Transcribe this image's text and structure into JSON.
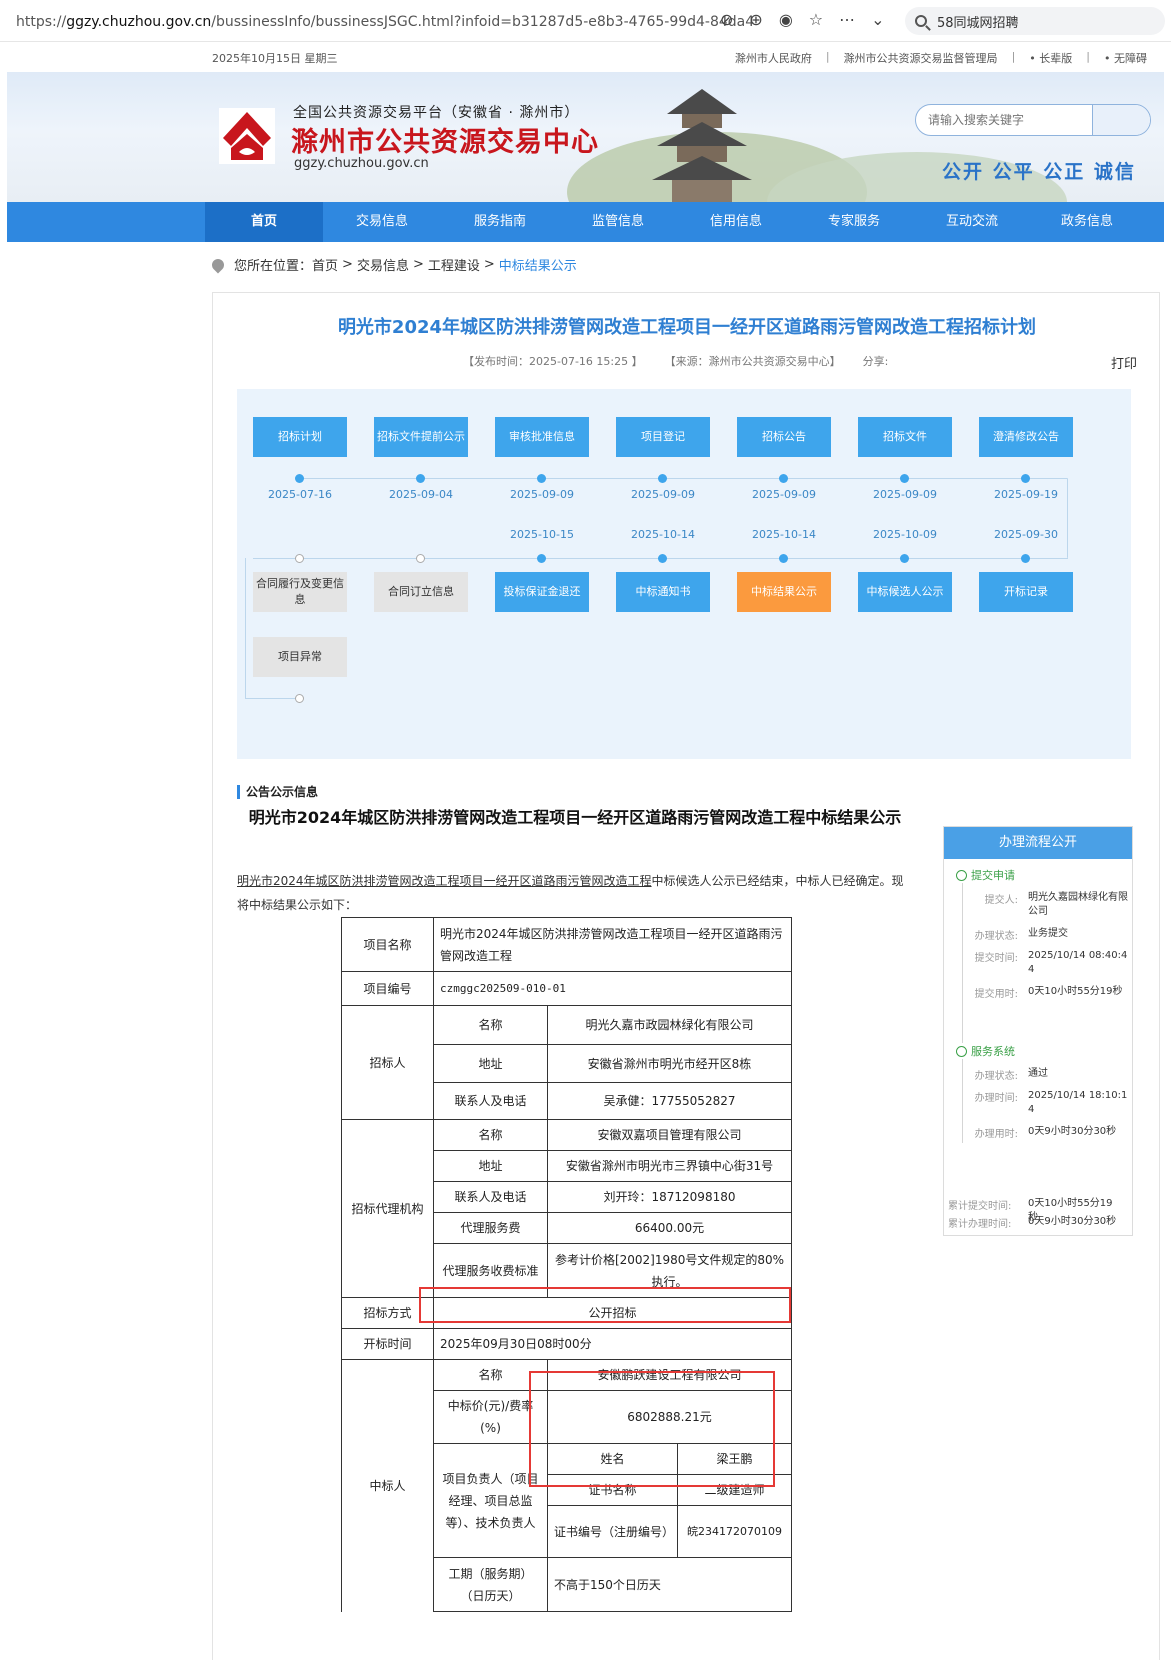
{
  "browser": {
    "url_prefix": "https://",
    "url_host": "ggzy.chuzhou.gov.cn",
    "url_rest": "/bussinessInfo/bussinessJSGC.html?infoid=b31287d5-e8b3-4765-99d4-84da4",
    "search_text": "58同城网招聘"
  },
  "topbar": {
    "date": "2025年10月15日  星期三",
    "link1": "滁州市人民政府",
    "link2": "滁州市公共资源交易监督管理局",
    "link3": "长辈版",
    "link4": "无障碍",
    "sep": "|"
  },
  "banner": {
    "line1": "全国公共资源交易平台（安徽省 · 滁州市）",
    "line2": "滁州市公共资源交易中心",
    "line3": "ggzy.chuzhou.gov.cn",
    "search_placeholder": "请输入搜索关键字",
    "slogan": "公开  公平  公正  诚信"
  },
  "nav": [
    "首页",
    "交易信息",
    "服务指南",
    "监管信息",
    "信用信息",
    "专家服务",
    "互动交流",
    "政务信息"
  ],
  "breadcrumb": {
    "label": "您所在位置：",
    "items": [
      "首页",
      "交易信息",
      "工程建设"
    ],
    "current": "中标结果公示",
    "sep": ">"
  },
  "article": {
    "title": "明光市2024年城区防洪排涝管网改造工程项目一经开区道路雨污管网改造工程招标计划",
    "publish": "【发布时间：2025-07-16 15:25 】",
    "source": "【来源：滁州市公共资源交易中心】",
    "share": "分享:",
    "print": "打印"
  },
  "flow": {
    "top": [
      "招标计划",
      "招标文件提前公示",
      "审核批准信息",
      "项目登记",
      "招标公告",
      "招标文件",
      "澄清修改公告"
    ],
    "dates1": [
      "2025-07-16",
      "2025-09-04",
      "2025-09-09",
      "2025-09-09",
      "2025-09-09",
      "2025-09-09",
      "2025-09-19"
    ],
    "dates2": [
      "2025-10-15",
      "2025-10-14",
      "2025-10-14",
      "2025-10-09",
      "2025-09-30"
    ],
    "bottom": [
      "合同履行及变更信息",
      "合同订立信息",
      "投标保证金退还",
      "中标通知书",
      "中标结果公示",
      "中标候选人公示",
      "开标记录"
    ],
    "extra": "项目异常"
  },
  "notice": {
    "section": "公告公示信息",
    "title": "明光市2024年城区防洪排涝管网改造工程项目一经开区道路雨污管网改造工程中标结果公示",
    "intro_link": "明光市2024年城区防洪排涝管网改造工程项目一经开区道路雨污管网改造工程",
    "intro_rest": "中标候选人公示已经结束，中标人已经确定。现将中标结果公示如下："
  },
  "table": {
    "project_name_label": "项目名称",
    "project_name": "明光市2024年城区防洪排涝管网改造工程项目一经开区道路雨污管网改造工程",
    "project_no_label": "项目编号",
    "project_no": "czmggc202509-010-01",
    "tenderer_label": "招标人",
    "name_label": "名称",
    "addr_label": "地址",
    "contact_label": "联系人及电话",
    "tenderer_name": "明光久嘉市政园林绿化有限公司",
    "tenderer_addr": "安徽省滁州市明光市经开区8栋",
    "tenderer_contact": "吴承健：17755052827",
    "agency_label": "招标代理机构",
    "agency_name": "安徽双嘉项目管理有限公司",
    "agency_addr": "安徽省滁州市明光市三界镇中心街31号",
    "agency_contact": "刘开玲：18712098180",
    "fee_label": "代理服务费",
    "fee": "66400.00元",
    "fee_std_label": "代理服务收费标准",
    "fee_std": "参考计价格[2002]1980号文件规定的80%执行。",
    "method_label": "招标方式",
    "method": "公开招标",
    "open_label": "开标时间",
    "open_time": "2025年09月30日08时00分",
    "winner_label": "中标人",
    "winner_name": "安徽鹏跃建设工程有限公司",
    "price_label": "中标价(元)/费率(%)",
    "price": "6802888.21元",
    "pm_label": "项目负责人（项目经理、项目总监等）、技术负责人",
    "person_label": "姓名",
    "person_name": "梁王鹏",
    "cert_label": "证书名称",
    "cert_name": "二级建造师",
    "cert_no_label": "证书编号（注册编号）",
    "cert_no": "皖234172070109",
    "period_label": "工期（服务期）（日历天）",
    "period": "不高于150个日历天"
  },
  "side": {
    "header": "办理流程公开",
    "step1": "提交申请",
    "s1_k1": "提交人:",
    "s1_v1": "明光久嘉园林绿化有限公司",
    "s1_k2": "办理状态:",
    "s1_v2": "业务提交",
    "s1_k3": "提交时间:",
    "s1_v3": "2025/10/14 08:40:44",
    "s1_k4": "提交用时:",
    "s1_v4": "0天10小时55分19秒",
    "step2": "服务系统",
    "s2_k1": "办理状态:",
    "s2_v1": "通过",
    "s2_k2": "办理时间:",
    "s2_v2": "2025/10/14 18:10:14",
    "s2_k3": "办理用时:",
    "s2_v3": "0天9小时30分30秒",
    "t1_k": "累计提交时间:",
    "t1_v": "0天10小时55分19秒",
    "t2_k": "累计办理时间:",
    "t2_v": "0天9小时30分30秒"
  },
  "colors": {
    "primary": "#2f88e0",
    "orange": "#fb9a3e",
    "red": "#c8161d",
    "highlight": "#e53935"
  }
}
